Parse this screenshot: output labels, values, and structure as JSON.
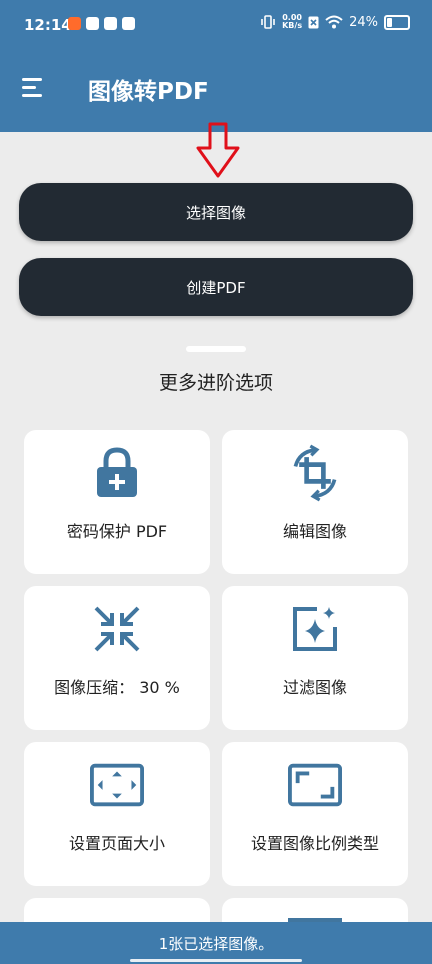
{
  "status": {
    "time": "12:14",
    "speed_value": "0.00",
    "speed_unit": "KB/s",
    "battery": "24%"
  },
  "appbar": {
    "title": "图像转PDF"
  },
  "buttons": {
    "select_images": "选择图像",
    "create_pdf": "创建PDF"
  },
  "section": {
    "title": "更多进阶选项"
  },
  "options": [
    {
      "label": "密码保护 PDF",
      "icon": "lock-plus-icon"
    },
    {
      "label": "编辑图像",
      "icon": "crop-rotate-icon"
    },
    {
      "label": "图像压缩：  30 %",
      "icon": "compress-icon"
    },
    {
      "label": "过滤图像",
      "icon": "filter-sparkle-icon"
    },
    {
      "label": "设置页面大小",
      "icon": "page-size-icon"
    },
    {
      "label": "设置图像比例类型",
      "icon": "aspect-ratio-icon"
    }
  ],
  "snackbar": {
    "message": "1张已选择图像。"
  },
  "colors": {
    "primary": "#3f7bac",
    "button_dark": "#222a33",
    "icon_blue": "#41769f",
    "arrow_red": "#e0101a"
  }
}
